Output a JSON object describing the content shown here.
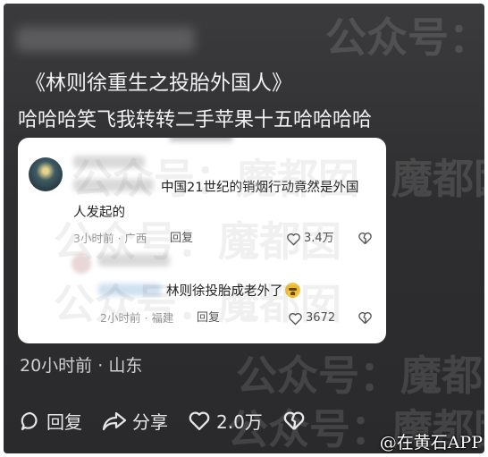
{
  "post": {
    "title": "《林则徐重生之投胎外国人》",
    "body": "哈哈哈笑飞我转转二手苹果十五哈哈哈哈"
  },
  "screenshot": {
    "comments": [
      {
        "text_line1": "中国21世纪的销烟行动竟然是外国",
        "text_line2": "人发起的",
        "time": "3小时前",
        "location": "广西",
        "reply_label": "回复",
        "likes": "3.4万"
      },
      {
        "text": "林则徐投胎成老外了",
        "time": "2小时前",
        "location": "福建",
        "reply_label": "回复",
        "likes": "3672"
      }
    ],
    "separator": "·"
  },
  "meta": {
    "time": "20小时前",
    "separator": "·",
    "location": "山东"
  },
  "actions": {
    "reply_label": "回复",
    "share_label": "分享",
    "like_count": "2.0万"
  },
  "watermark": {
    "text": "公众号：魔都囡",
    "footer": "@在黄石APP"
  },
  "colors": {
    "background": "#2e2e30",
    "card": "#ffffff",
    "text_light": "#f2f2f2"
  }
}
